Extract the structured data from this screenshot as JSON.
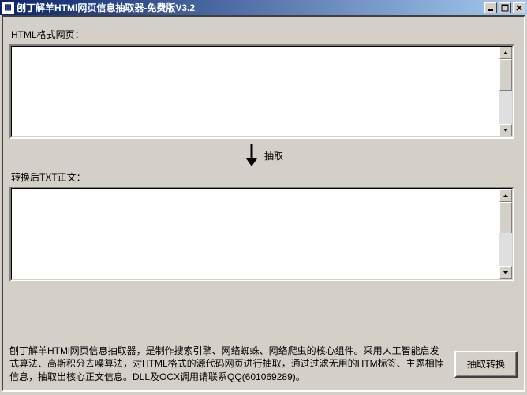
{
  "titlebar": {
    "title": "刨丁解羊HTMl网页信息抽取器-免费版V3.2"
  },
  "labels": {
    "input": "HTML格式网页：",
    "arrow": "抽取",
    "output": "转换后TXT正文："
  },
  "fields": {
    "input_value": "",
    "output_value": ""
  },
  "footer": {
    "description": "刨丁解羊HTMl网页信息抽取器，是制作搜索引擎、网络蜘蛛、网络爬虫的核心组件。采用人工智能启发式算法、高斯积分去噪算法，对HTML格式的源代码网页进行抽取，通过过滤无用的HTM标签、主题相悖信息，抽取出核心正文信息。DLL及OCX调用请联系QQ(601069289)。",
    "button": "抽取转换"
  }
}
